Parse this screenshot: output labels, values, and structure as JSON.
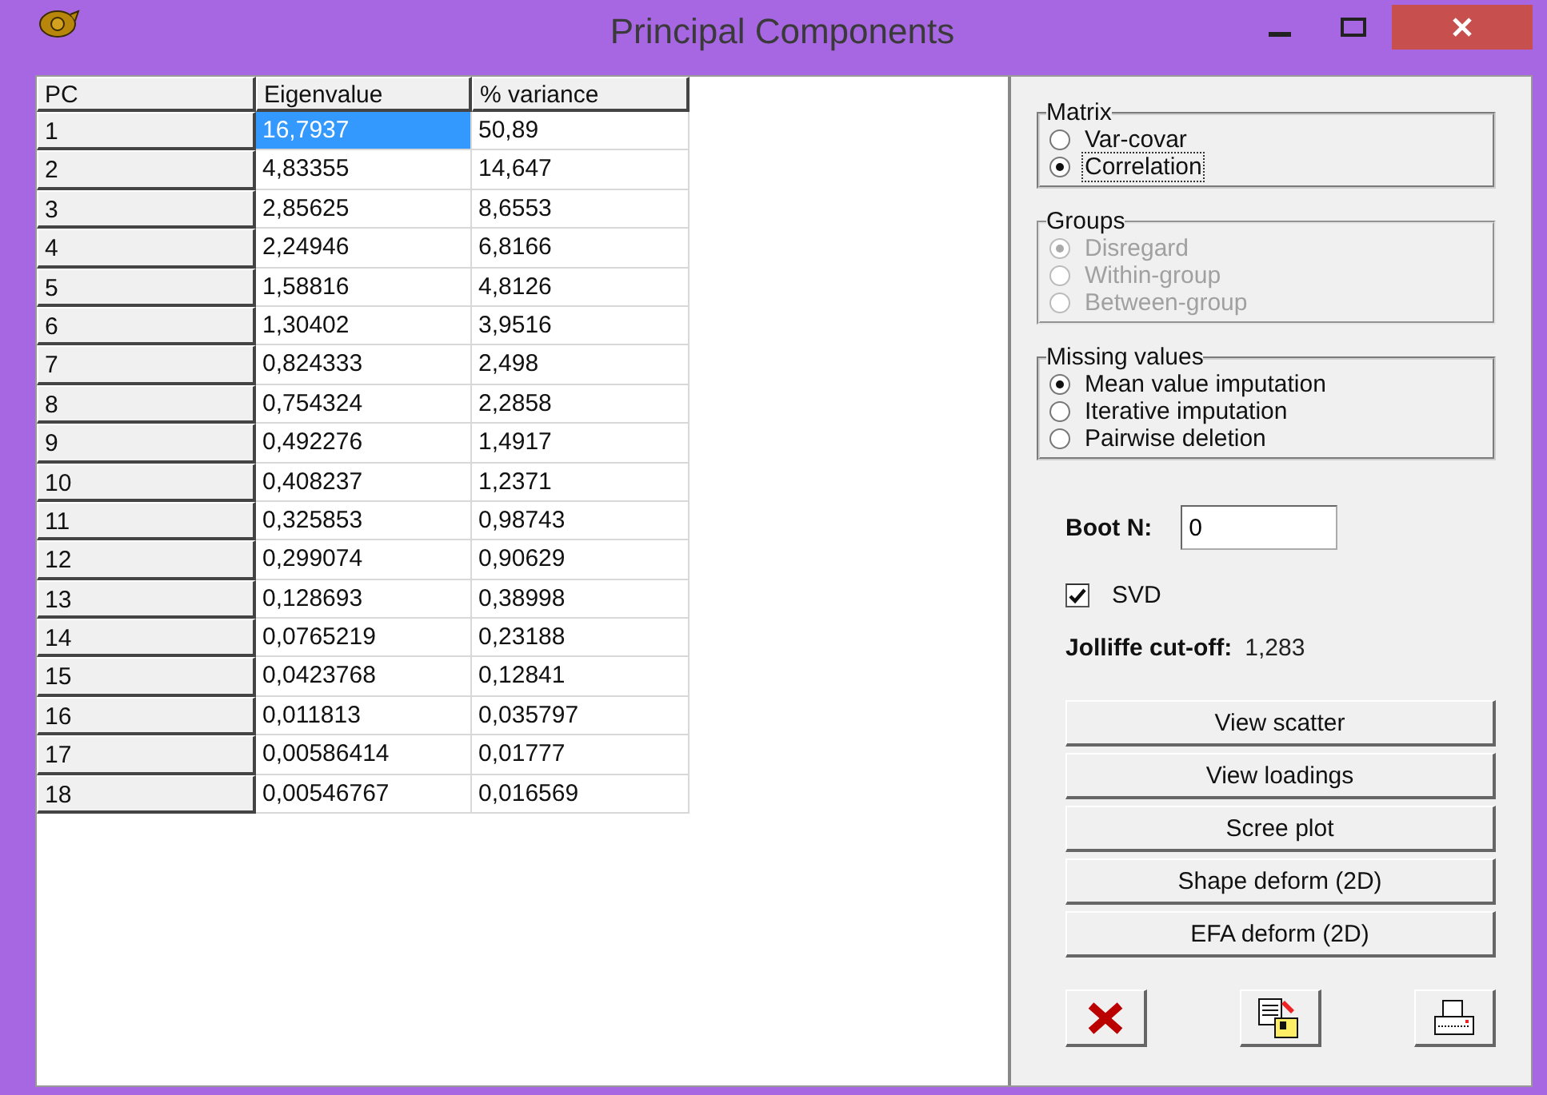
{
  "window": {
    "title": "Principal Components"
  },
  "table": {
    "columns": [
      "PC",
      "Eigenvalue",
      "% variance"
    ],
    "rows": [
      {
        "cells": [
          {
            "text": "1"
          },
          {
            "text": "16,7937",
            "selected": true
          },
          {
            "text": "50,89",
            "selected": false
          }
        ]
      },
      {
        "cells": [
          {
            "text": "2"
          },
          {
            "text": "4,83355",
            "selected": false
          },
          {
            "text": "14,647",
            "selected": false
          }
        ]
      },
      {
        "cells": [
          {
            "text": "3"
          },
          {
            "text": "2,85625",
            "selected": false
          },
          {
            "text": "8,6553",
            "selected": false
          }
        ]
      },
      {
        "cells": [
          {
            "text": "4"
          },
          {
            "text": "2,24946",
            "selected": false
          },
          {
            "text": "6,8166",
            "selected": false
          }
        ]
      },
      {
        "cells": [
          {
            "text": "5"
          },
          {
            "text": "1,58816",
            "selected": false
          },
          {
            "text": "4,8126",
            "selected": false
          }
        ]
      },
      {
        "cells": [
          {
            "text": "6"
          },
          {
            "text": "1,30402",
            "selected": false
          },
          {
            "text": "3,9516",
            "selected": false
          }
        ]
      },
      {
        "cells": [
          {
            "text": "7"
          },
          {
            "text": "0,824333",
            "selected": false
          },
          {
            "text": "2,498",
            "selected": false
          }
        ]
      },
      {
        "cells": [
          {
            "text": "8"
          },
          {
            "text": "0,754324",
            "selected": false
          },
          {
            "text": "2,2858",
            "selected": false
          }
        ]
      },
      {
        "cells": [
          {
            "text": "9"
          },
          {
            "text": "0,492276",
            "selected": false
          },
          {
            "text": "1,4917",
            "selected": false
          }
        ]
      },
      {
        "cells": [
          {
            "text": "10"
          },
          {
            "text": "0,408237",
            "selected": false
          },
          {
            "text": "1,2371",
            "selected": false
          }
        ]
      },
      {
        "cells": [
          {
            "text": "11"
          },
          {
            "text": "0,325853",
            "selected": false
          },
          {
            "text": "0,98743",
            "selected": false
          }
        ]
      },
      {
        "cells": [
          {
            "text": "12"
          },
          {
            "text": "0,299074",
            "selected": false
          },
          {
            "text": "0,90629",
            "selected": false
          }
        ]
      },
      {
        "cells": [
          {
            "text": "13"
          },
          {
            "text": "0,128693",
            "selected": false
          },
          {
            "text": "0,38998",
            "selected": false
          }
        ]
      },
      {
        "cells": [
          {
            "text": "14"
          },
          {
            "text": "0,0765219",
            "selected": false
          },
          {
            "text": "0,23188",
            "selected": false
          }
        ]
      },
      {
        "cells": [
          {
            "text": "15"
          },
          {
            "text": "0,0423768",
            "selected": false
          },
          {
            "text": "0,12841",
            "selected": false
          }
        ]
      },
      {
        "cells": [
          {
            "text": "16"
          },
          {
            "text": "0,011813",
            "selected": false
          },
          {
            "text": "0,035797",
            "selected": false
          }
        ]
      },
      {
        "cells": [
          {
            "text": "17"
          },
          {
            "text": "0,00586414",
            "selected": false
          },
          {
            "text": "0,01777",
            "selected": false
          }
        ]
      },
      {
        "cells": [
          {
            "text": "18"
          },
          {
            "text": "0,00546767",
            "selected": false
          },
          {
            "text": "0,016569",
            "selected": false
          }
        ]
      }
    ]
  },
  "groups": [
    {
      "title": "Matrix",
      "disabled": false,
      "options": [
        {
          "label": "Var-covar",
          "selected": false,
          "focused": false
        },
        {
          "label": "Correlation",
          "selected": true,
          "focused": true
        }
      ]
    },
    {
      "title": "Groups",
      "disabled": true,
      "options": [
        {
          "label": "Disregard",
          "selected": true,
          "focused": false
        },
        {
          "label": "Within-group",
          "selected": false,
          "focused": false
        },
        {
          "label": "Between-group",
          "selected": false,
          "focused": false
        }
      ]
    },
    {
      "title": "Missing values",
      "disabled": false,
      "options": [
        {
          "label": "Mean value imputation",
          "selected": true,
          "focused": false
        },
        {
          "label": "Iterative imputation",
          "selected": false,
          "focused": false
        },
        {
          "label": "Pairwise deletion",
          "selected": false,
          "focused": false
        }
      ]
    }
  ],
  "boot": {
    "label": "Boot N:",
    "value": "0"
  },
  "svd": {
    "label": "SVD",
    "checked": true
  },
  "jolliffe": {
    "label": "Jolliffe cut-off:",
    "value": "1,283"
  },
  "buttons": [
    "View scatter",
    "View loadings",
    "Scree plot",
    "Shape deform (2D)",
    "EFA deform (2D)"
  ],
  "icon_buttons": [
    {
      "kind": "close"
    },
    {
      "kind": "copy"
    },
    {
      "kind": "print"
    }
  ]
}
